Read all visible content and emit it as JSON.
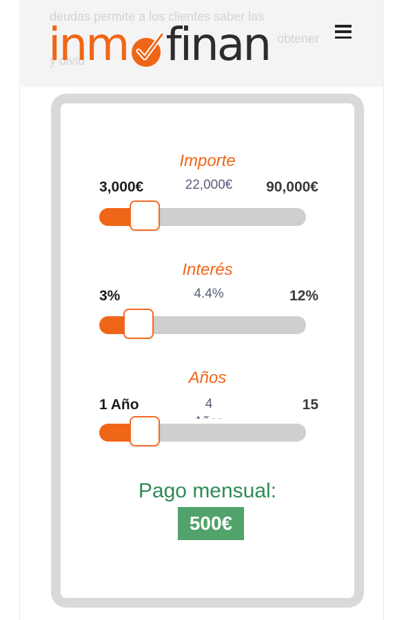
{
  "background_text": {
    "line1": "deudas permite a los clientes saber las",
    "line2": "obtener",
    "line3": "y divid"
  },
  "brand": {
    "logo_text_left": "inm",
    "logo_text_right": "finan",
    "accent_color": "#f06618",
    "dark_color": "#2d2d2d"
  },
  "menu": {
    "icon": "hamburger-menu-icon"
  },
  "calculator": {
    "importe": {
      "title": "Importe",
      "min": "3,000€",
      "current": "22,000€",
      "max": "90,000€",
      "fill_fraction": 0.22
    },
    "interes": {
      "title": "Interés",
      "min": "3%",
      "current": "4.4%",
      "max": "12%",
      "fill_fraction": 0.19
    },
    "anos": {
      "title": "Años",
      "min": "1 Año",
      "current": "4",
      "current_unit": "Años",
      "max": "15",
      "fill_fraction": 0.22
    },
    "result_label": "Pago mensual:",
    "result_value": "500€",
    "result_color": "#52a26b"
  }
}
